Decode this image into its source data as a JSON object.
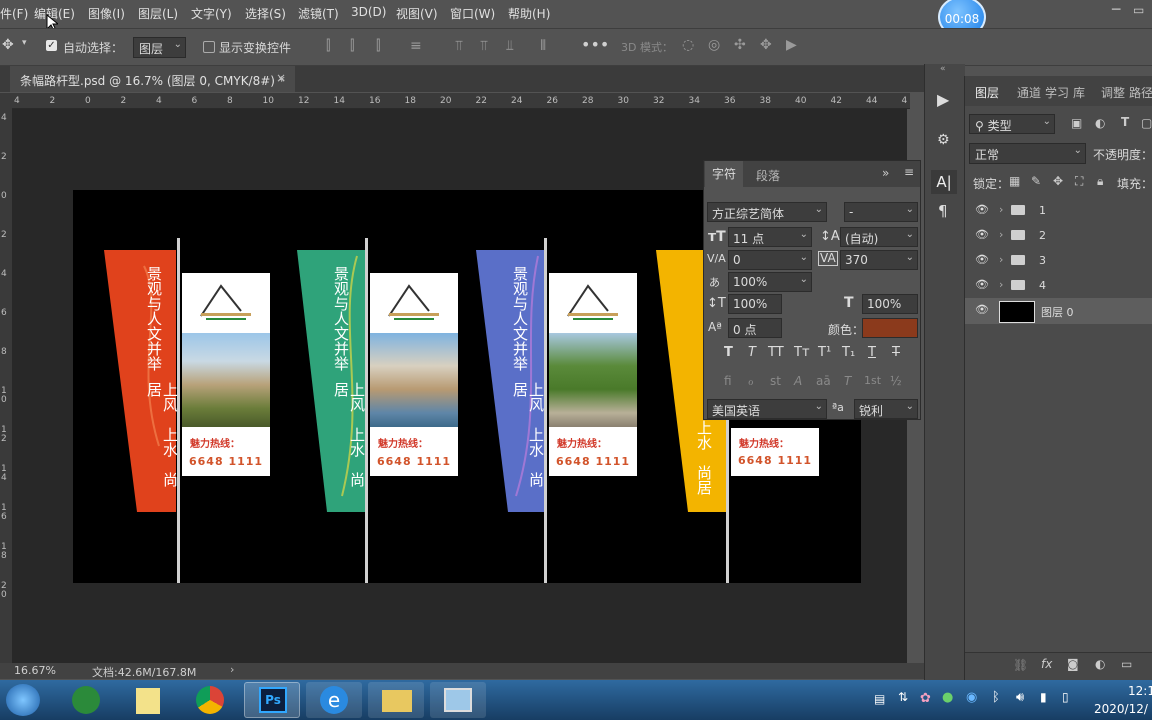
{
  "menu": [
    "件(F)",
    "编辑(E)",
    "图像(I)",
    "图层(L)",
    "文字(Y)",
    "选择(S)",
    "滤镜(T)",
    "3D(D)",
    "视图(V)",
    "窗口(W)",
    "帮助(H)"
  ],
  "timer": "00:08",
  "options": {
    "auto_select_label": "自动选择：",
    "auto_select_target": "图层",
    "show_transform_label": "显示变换控件",
    "mode_3d_label": "3D 模式："
  },
  "document": {
    "tab_title": "条幅路杆型.psd @ 16.7% (图层 0, CMYK/8#) *",
    "zoom": "16.67%",
    "doc_size": "文档:42.6M/167.8M"
  },
  "ruler_top": [
    "4",
    "2",
    "0",
    "2",
    "4",
    "6",
    "8",
    "10",
    "12",
    "14",
    "16",
    "18",
    "20",
    "22",
    "24",
    "26",
    "28",
    "30",
    "32",
    "34",
    "36",
    "38",
    "40",
    "42",
    "44",
    "4"
  ],
  "ruler_left": [
    "4",
    "2",
    "0",
    "2",
    "4",
    "6",
    "8",
    "1 0",
    "1 2",
    "1 4",
    "1 6",
    "1 8",
    "2 0"
  ],
  "layers_panel": {
    "tabs": [
      "图层",
      "通道",
      "学习",
      "库",
      "调整",
      "路径"
    ],
    "filter_kind": "类型",
    "blend_mode": "正常",
    "opacity_label": "不透明度：",
    "lock_label": "锁定：",
    "fill_label": "填充：",
    "layers": [
      {
        "name": "1",
        "type": "group"
      },
      {
        "name": "2",
        "type": "group"
      },
      {
        "name": "3",
        "type": "group"
      },
      {
        "name": "4",
        "type": "group"
      },
      {
        "name": "图层 0",
        "type": "layer"
      }
    ]
  },
  "character_panel": {
    "tabs": [
      "字符",
      "段落"
    ],
    "font_family": "方正综艺简体",
    "font_style": "-",
    "font_size": "11 点",
    "leading": "(自动)",
    "kerning": "0",
    "tracking": "370",
    "tsume": "100%",
    "vertical_scale": "100%",
    "horizontal_scale": "100%",
    "baseline_shift": "0 点",
    "color_label": "颜色：",
    "color": "#8b3a1c",
    "style_buttons": [
      "T",
      "T",
      "TT",
      "Tт",
      "T¹",
      "T₁",
      "T",
      "T"
    ],
    "opentype_buttons": [
      "fi",
      "ℴ",
      "st",
      "A",
      "aā",
      "T",
      "1st",
      "½"
    ],
    "language": "美国英语",
    "aa_label": "ªa",
    "antialias": "锐利"
  },
  "artwork": {
    "banners": [
      {
        "flag_color": "#e0421c",
        "flag_text": "景观与人文并举",
        "flag_text2": "上风　上水　尚居"
      },
      {
        "flag_color": "#2fa37a",
        "flag_text": "景观与人文并举",
        "flag_text2": "上风　上水　尚居"
      },
      {
        "flag_color": "#5a6fc8",
        "flag_text": "景观与人文并举",
        "flag_text2": "上风　上水　尚居"
      },
      {
        "flag_color": "#f3b400",
        "flag_text": "",
        "flag_text2": "上水　尚居"
      }
    ],
    "hotline_label": "魅力热线：",
    "phone": "6648 1111"
  },
  "taskbar": {
    "clock_time": "12:1",
    "clock_date": "2020/12/"
  }
}
